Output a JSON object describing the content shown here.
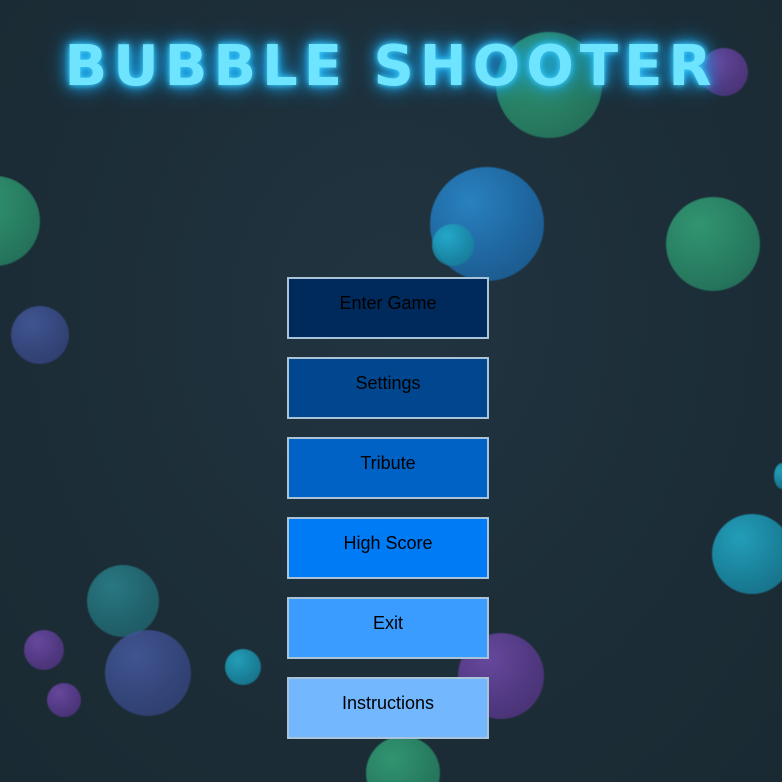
{
  "title": "BUBBLE SHOOTER",
  "menu": {
    "items": [
      {
        "label": "Enter Game",
        "color": "#002a5c"
      },
      {
        "label": "Settings",
        "color": "#00478f"
      },
      {
        "label": "Tribute",
        "color": "#0062c5"
      },
      {
        "label": "High Score",
        "color": "#007bf6"
      },
      {
        "label": "Exit",
        "color": "#3a9cff"
      },
      {
        "label": "Instructions",
        "color": "#73b8ff"
      }
    ]
  },
  "colors": {
    "background": "#1d2e38",
    "title_glow": "#6fe4ff",
    "button_border": "#a9c3d8"
  }
}
